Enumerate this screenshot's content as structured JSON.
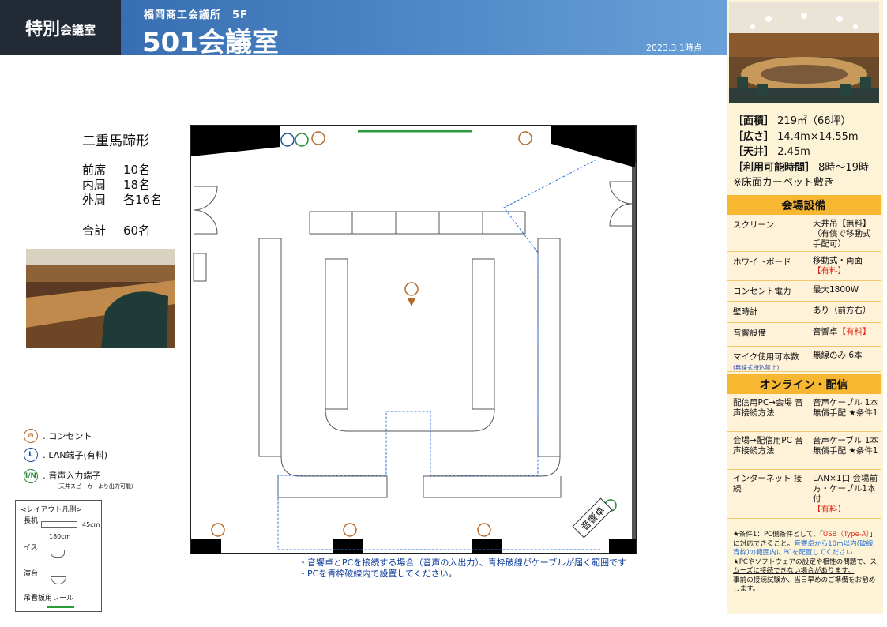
{
  "header": {
    "badge_big": "特別",
    "badge_small": "会議室",
    "building": "福岡商工会議所　5F",
    "room": "501会議室",
    "date": "2023.3.1時点"
  },
  "specs": [
    {
      "label": "［面積］",
      "value": "219㎡（66坪）"
    },
    {
      "label": "［広さ］",
      "value": "14.4m×14.55m"
    },
    {
      "label": "［天井］",
      "value": "2.45m"
    },
    {
      "label": "［利用可能時間］",
      "value": "8時～19時"
    }
  ],
  "floor_note": "※床面カーペット敷き",
  "equipment": {
    "title": "会場設備",
    "rows": [
      {
        "name": "スクリーン",
        "value": "天井吊【無料】（有償で移動式 手配可）",
        "extra": ""
      },
      {
        "name": "ホワイトボード",
        "value": "移動式・両面",
        "extra": "【有料】"
      },
      {
        "name": "コンセント電力",
        "value": "最大1800W",
        "extra": ""
      },
      {
        "name": "壁時計",
        "value": "あり（前方右）",
        "extra": ""
      },
      {
        "name": "音響設備",
        "value": "音響卓",
        "extra": "【有料】"
      },
      {
        "name": "マイク使用可本数",
        "sub": "(無線式持込禁止)",
        "value": "無線のみ 6本",
        "extra": ""
      }
    ]
  },
  "online": {
    "title": "オンライン・配信",
    "rows": [
      {
        "name": "配信用PC→会場 音声接続方法",
        "value": "音声ケーブル 1本無償手配 ★条件1",
        "extra": ""
      },
      {
        "name": "会場→配信用PC 音声接続方法",
        "value": "音声ケーブル 1本無償手配 ★条件1",
        "extra": ""
      },
      {
        "name": "インターネット 接続",
        "value": "LAN×1口 会場前方・ケーブル1本付",
        "extra": "【有料】"
      }
    ]
  },
  "condition_note": {
    "a": "★条件1：PC側条件として、「",
    "b": "USB（Type-A）",
    "c": "」に対応できること。",
    "d": "音響卓から10m以内(破線青枠)の範囲内にPCを配置してください",
    "e": "★PCやソフトウェアの設定や相性の問題で、スムーズに接続できない場合があります。",
    "f": "事前の接続試験か、当日早めのご準備をお勧めします。"
  },
  "layout": {
    "name": "二重馬蹄形",
    "rows": [
      {
        "k": "前席",
        "v": "10名"
      },
      {
        "k": "内周",
        "v": "18名"
      },
      {
        "k": "外周",
        "v": "各16名"
      }
    ],
    "total_k": "合計",
    "total_v": "60名"
  },
  "legend": {
    "outlet": "‥コンセント",
    "lan": "‥LAN端子(有料)",
    "audio": "‥音声入力端子",
    "audio_sub": "（天井スピーカーより出力可能）"
  },
  "layout_legend": {
    "title": "<レイアウト凡例>",
    "desk": "長机",
    "w": "180cm",
    "h": "45cm",
    "chair": "イス",
    "podium": "演台",
    "rail": "吊看板用レール"
  },
  "plan": {
    "mixer": "音響卓",
    "note1": "・音響卓とPCを接続する場合（音声の入出力）、青枠破線がケーブルが届く範囲です",
    "note2": "・PCを青枠破線内で設置してください。"
  },
  "colors": {
    "header": "#3a74b8",
    "accent": "#f7b731",
    "dash": "#2a72d8"
  }
}
